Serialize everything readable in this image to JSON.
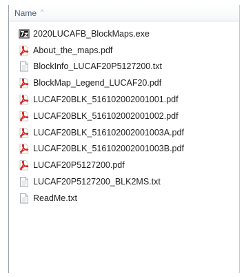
{
  "header": {
    "column_label": "Name",
    "sort_indicator": "^"
  },
  "files": [
    {
      "name": "2020LUCAFB_BlockMaps.exe",
      "icon": "7z-archive-icon"
    },
    {
      "name": "About_the_maps.pdf",
      "icon": "pdf-icon"
    },
    {
      "name": "BlockInfo_LUCAF20P5127200.txt",
      "icon": "text-file-icon"
    },
    {
      "name": "BlockMap_Legend_LUCAF20.pdf",
      "icon": "pdf-icon"
    },
    {
      "name": "LUCAF20BLK_516102002001001.pdf",
      "icon": "pdf-icon"
    },
    {
      "name": "LUCAF20BLK_516102002001002.pdf",
      "icon": "pdf-icon"
    },
    {
      "name": "LUCAF20BLK_516102002001003A.pdf",
      "icon": "pdf-icon"
    },
    {
      "name": "LUCAF20BLK_516102002001003B.pdf",
      "icon": "pdf-icon"
    },
    {
      "name": "LUCAF20P5127200.pdf",
      "icon": "pdf-icon"
    },
    {
      "name": "LUCAF20P5127200_BLK2MS.txt",
      "icon": "text-file-icon"
    },
    {
      "name": "ReadMe.txt",
      "icon": "text-file-icon"
    }
  ],
  "colors": {
    "pdf_red": "#d9261c",
    "header_text": "#4c607a"
  }
}
